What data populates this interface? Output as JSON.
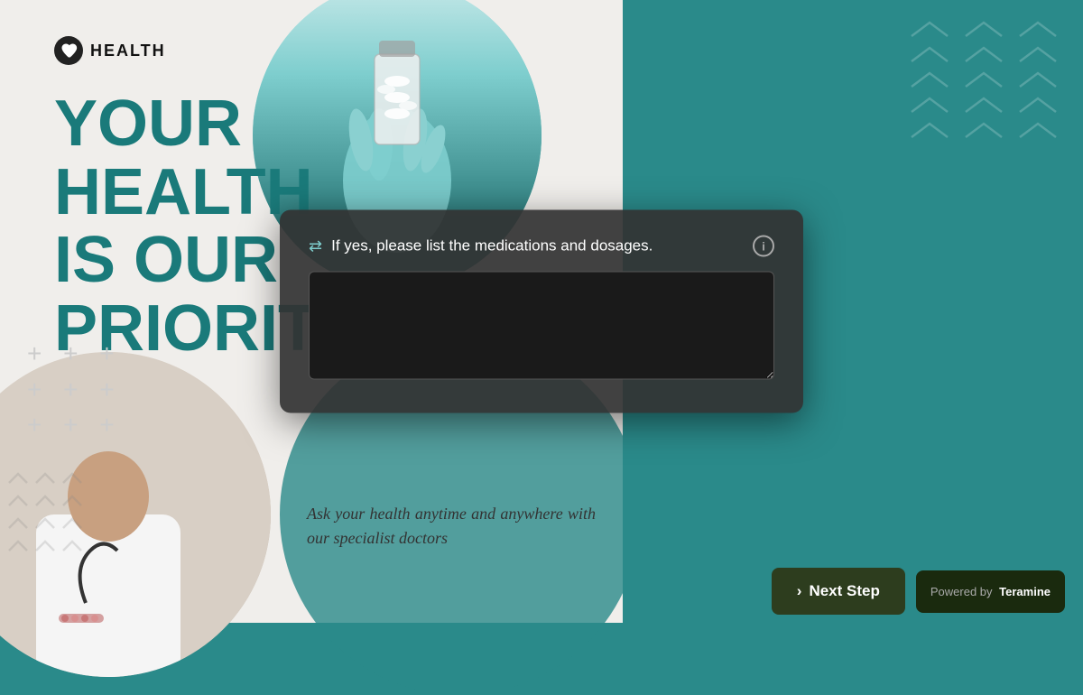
{
  "app": {
    "title": "HEALTH"
  },
  "logo": {
    "text": "HEALTH",
    "icon": "heartbeat-icon"
  },
  "hero": {
    "line1": "YOUR",
    "line2": "HEALTH",
    "line3": "IS OUR",
    "line4": "PRIORITY"
  },
  "tagline": {
    "text": "Ask your health anytime and anywhere with our specialist doctors"
  },
  "modal": {
    "question": "If yes, please list the medications and dosages.",
    "info_icon_label": "i",
    "textarea_placeholder": "",
    "lines_icon": "≡"
  },
  "footer": {
    "next_step_label": "Next Step",
    "next_arrow": "›",
    "powered_by_prefix": "Powered by",
    "powered_by_brand": "Teramine"
  }
}
